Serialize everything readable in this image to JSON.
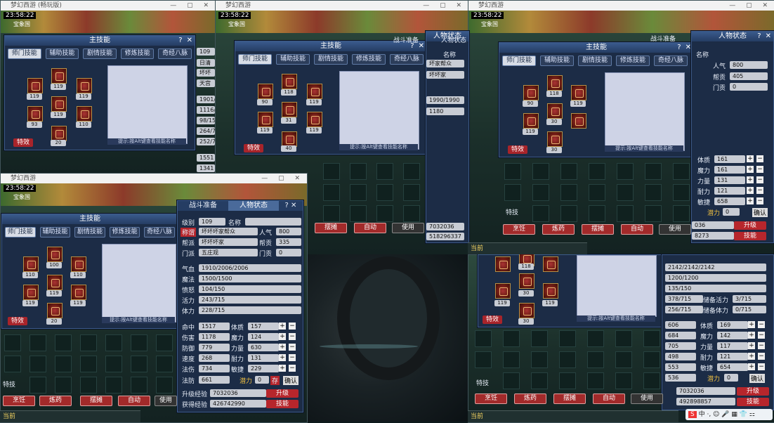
{
  "app_title": "梦幻西游",
  "window_title_suffix": "(畅玩版)",
  "clock": "23:58:22",
  "city": "宝象国",
  "skills_panel": {
    "title": "主技能",
    "tabs": [
      "师门技能",
      "辅助技能",
      "剧情技能",
      "修炼技能",
      "奇经八脉"
    ],
    "hint": "提示:按Alt键查看技能名称",
    "effect_button": "特效"
  },
  "char_skill_levels_A": [
    "119",
    "119",
    "119",
    "119",
    "93",
    "110",
    "20"
  ],
  "char_skill_levels_B": [
    "90",
    "118",
    "119",
    "31",
    "119",
    "40",
    "119"
  ],
  "char_skill_levels_C": [
    "110",
    "100",
    "110",
    "119",
    "119",
    "119",
    "20"
  ],
  "char_skill_levels_D": [
    "90",
    "118",
    "119",
    "30",
    "119",
    "30"
  ],
  "battle_prep_label": "战斗准备",
  "status_panel": {
    "title": "人物状态",
    "level_label": "级别",
    "level": "109",
    "name_label": "名称",
    "title_label": "称谓",
    "title_value": "坏坏坏家帮众",
    "popularity_label": "人气",
    "popularity": "800",
    "gang_label": "帮派",
    "gang": "坏坏坏家",
    "contribution_label": "帮贡",
    "contribution": "335",
    "school_label": "门派",
    "school": "五庄观",
    "school_contrib_label": "门贡",
    "school_contrib": "0",
    "hp_label": "气血",
    "hp": "1910/2006/2006",
    "mp_label": "魔法",
    "mp": "1500/1500",
    "anger_label": "愤怒",
    "anger": "104/150",
    "vitality_label": "活力",
    "vitality": "243/715",
    "stamina_label": "体力",
    "stamina": "228/715",
    "hit_label": "命中",
    "hit": "1517",
    "con_label": "体质",
    "con": "157",
    "dmg_label": "伤害",
    "dmg": "1178",
    "mag_label": "魔力",
    "mag": "124",
    "def_label": "防御",
    "def": "779",
    "str_label": "力量",
    "str": "630",
    "spd_label": "速度",
    "spd": "268",
    "end_label": "耐力",
    "end": "131",
    "mdmg_label": "法伤",
    "mdmg": "734",
    "agi_label": "敏捷",
    "agi": "229",
    "mdef_label": "法防",
    "mdef": "661",
    "potential_label": "潜力",
    "potential": "0",
    "save_label": "存",
    "confirm_label": "确认",
    "upgrade_exp_label": "升级经验",
    "upgrade_exp": "7032036",
    "upgrade_button": "升级",
    "gained_exp_label": "获得经验",
    "gained_exp": "426742990",
    "skills_button": "技能"
  },
  "status_right": {
    "popularity": "800",
    "contribution": "405",
    "school_contrib": "0",
    "gang_prefix": "坏坏坏家帮众",
    "hp": "2142/2142/2142",
    "mp": "1200/1200",
    "anger": "135/150",
    "vitality": "378/715",
    "stamina": "256/715",
    "reserve_vit_label": "储备活力",
    "reserve_vit": "3/715",
    "reserve_sta_label": "储备体力",
    "reserve_sta": "0/715",
    "hit": "606",
    "con": "169",
    "dmg": "684",
    "mag": "142",
    "def": "705",
    "str": "117",
    "spd": "498",
    "end": "121",
    "mdmg": "553",
    "agi": "654",
    "mdef": "536",
    "upgrade_exp": "7032036",
    "gained_exp": "492898857",
    "mid_con": "161",
    "mid_mag": "161",
    "mid_str": "131",
    "mid_end": "121",
    "mid_agi": "658",
    "mid_gained": "8273",
    "mid_exp_tail": "036"
  },
  "top_mid_status": {
    "name_frag": "坏家帮众",
    "gang": "坏坏家",
    "hp": "1990/1990",
    "mp": "1180",
    "exp": "7032036",
    "gained": "518296337",
    "gained_label": "获得经验"
  },
  "left_partial": {
    "v1": "109",
    "v2": "日清",
    "v3": "坏坏",
    "v4": "天宫",
    "v5": "1901/",
    "v6": "1116/",
    "v7": "98/15",
    "v8": "264/7",
    "v9": "252/7",
    "v10": "1551",
    "v11": "1341"
  },
  "bottom_bar": {
    "cook": "烹饪",
    "alchemy": "炼药",
    "stall": "摆摊",
    "auto": "自动",
    "use": "使用",
    "special": "特技",
    "current": "当前"
  },
  "ime_text": "中"
}
